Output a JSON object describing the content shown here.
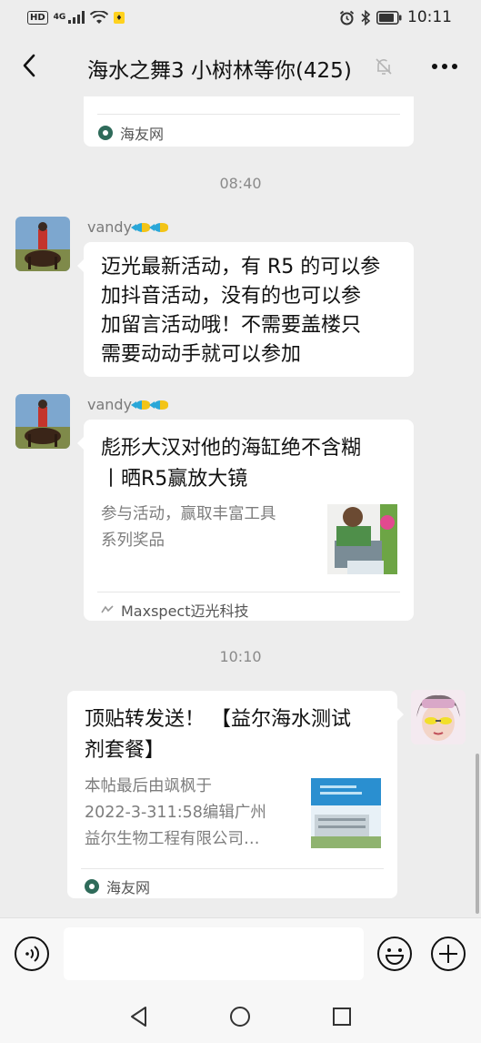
{
  "status_bar": {
    "hd": "HD",
    "network": "4G",
    "time": "10:11"
  },
  "header": {
    "title": "海水之舞3 小树林等你(425)"
  },
  "messages": {
    "top_card_source": "海友网",
    "time1": "08:40",
    "msg1": {
      "sender": "vandy",
      "text_lines": [
        "迈光最新活动，有 R5 的可以参",
        "加抖音活动，没有的也可以参",
        "加留言活动哦！不需要盖楼只",
        "需要动动手就可以参加"
      ]
    },
    "msg2": {
      "sender": "vandy",
      "title_lines": [
        "彪形大汉对他的海缸绝不含糊",
        "丨晒R5赢放大镜"
      ],
      "desc_lines": [
        "参与活动，赢取丰富工具",
        "系列奖品"
      ],
      "source": "Maxspect迈光科技"
    },
    "time2": "10:10",
    "msg3": {
      "title_lines": [
        "顶贴转发送！ 【益尔海水测试",
        "剂套餐】"
      ],
      "desc_lines": [
        "本帖最后由飒枫于",
        "2022-3-311:58编辑广州",
        "益尔生物工程有限公司…"
      ],
      "source": "海友网"
    }
  },
  "input_bar": {
    "placeholder": ""
  },
  "colors": {
    "background": "#ededed",
    "bubble": "#ffffff",
    "text": "#191919",
    "secondary": "#7d7d7d"
  },
  "icons": {
    "back": "chevron-left-icon",
    "mute": "mute-bell-icon",
    "more": "more-dots-icon",
    "voice": "voice-icon",
    "emoji": "emoji-icon",
    "plus": "plus-icon"
  }
}
